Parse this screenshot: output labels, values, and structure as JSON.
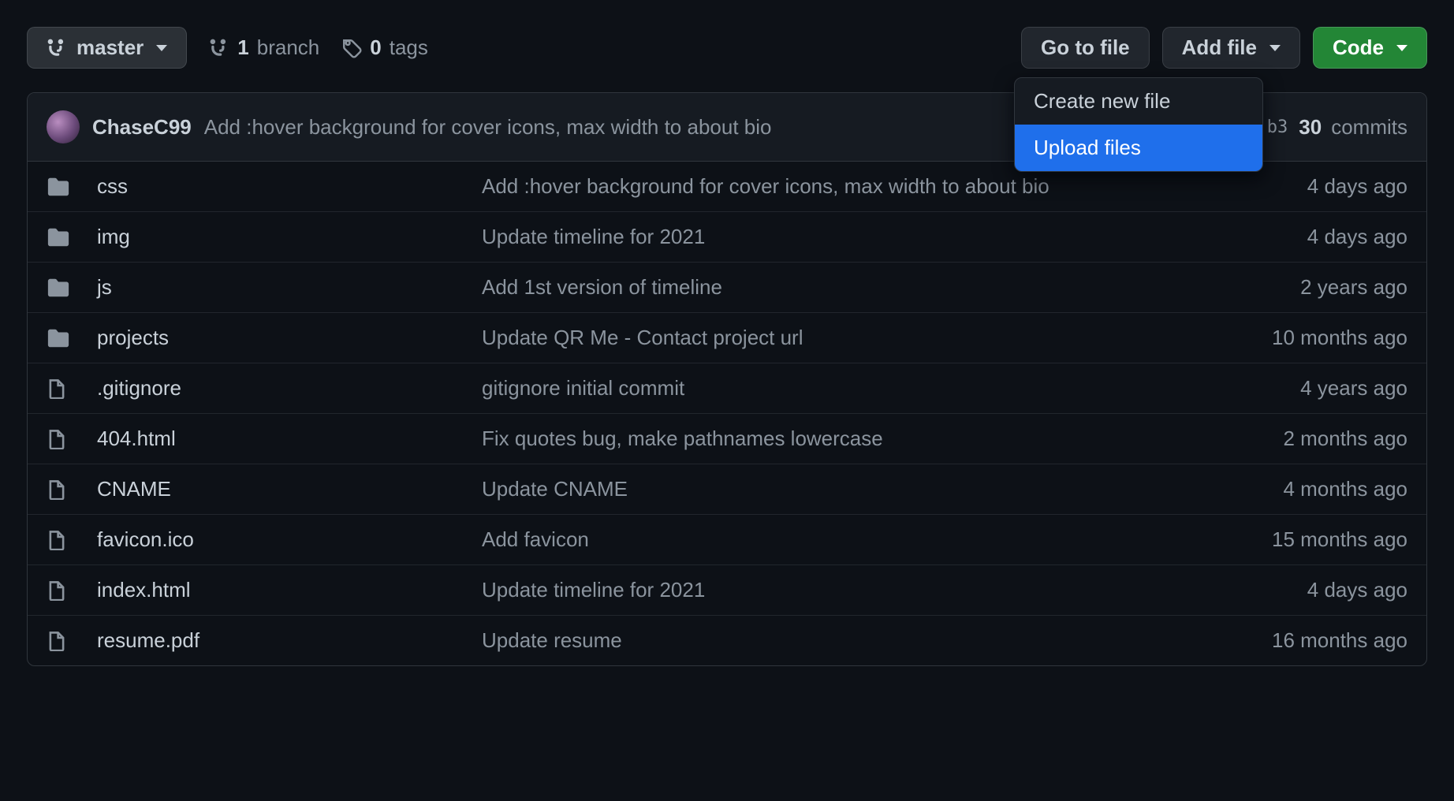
{
  "toolbar": {
    "branch_button": "master",
    "branch_count": "1",
    "branch_label": "branch",
    "tag_count": "0",
    "tag_label": "tags",
    "go_to_file": "Go to file",
    "add_file": "Add file",
    "code": "Code"
  },
  "dropdown": {
    "create_new_file": "Create new file",
    "upload_files": "Upload files"
  },
  "commit_header": {
    "author": "ChaseC99",
    "message": "Add :hover background for cover icons, max width to about bio",
    "hash_partial": "b3",
    "commits_count": "30",
    "commits_label": "commits"
  },
  "files": [
    {
      "type": "folder",
      "name": "css",
      "message": "Add :hover background for cover icons, max width to about bio",
      "time": "4 days ago"
    },
    {
      "type": "folder",
      "name": "img",
      "message": "Update timeline for 2021",
      "time": "4 days ago"
    },
    {
      "type": "folder",
      "name": "js",
      "message": "Add 1st version of timeline",
      "time": "2 years ago"
    },
    {
      "type": "folder",
      "name": "projects",
      "message": "Update QR Me - Contact project url",
      "time": "10 months ago"
    },
    {
      "type": "file",
      "name": ".gitignore",
      "message": "gitignore initial commit",
      "time": "4 years ago"
    },
    {
      "type": "file",
      "name": "404.html",
      "message": "Fix quotes bug, make pathnames lowercase",
      "time": "2 months ago"
    },
    {
      "type": "file",
      "name": "CNAME",
      "message": "Update CNAME",
      "time": "4 months ago"
    },
    {
      "type": "file",
      "name": "favicon.ico",
      "message": "Add favicon",
      "time": "15 months ago"
    },
    {
      "type": "file",
      "name": "index.html",
      "message": "Update timeline for 2021",
      "time": "4 days ago"
    },
    {
      "type": "file",
      "name": "resume.pdf",
      "message": "Update resume",
      "time": "16 months ago"
    }
  ]
}
